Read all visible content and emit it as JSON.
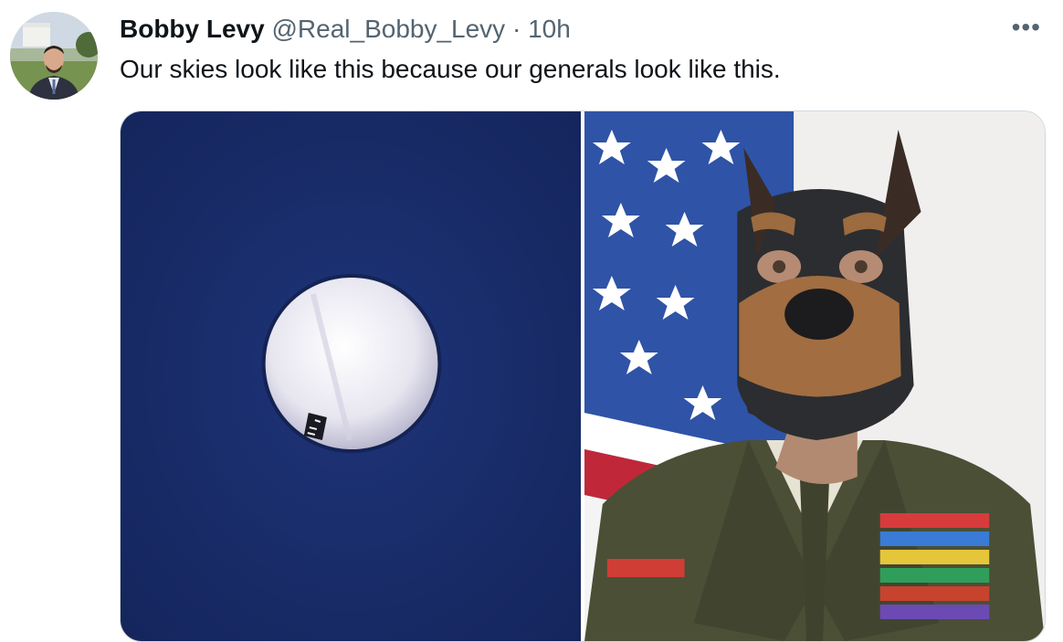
{
  "tweet": {
    "author_name": "Bobby Levy",
    "handle": "@Real_Bobby_Levy",
    "separator": "·",
    "time": "10h",
    "more_icon": "more-horizontal-icon",
    "more_glyph": "•••",
    "text": "Our skies look like this because our generals look like this."
  },
  "media": {
    "photos": [
      {
        "subject": "balloon-photo"
      },
      {
        "subject": "general-photo"
      }
    ]
  },
  "colors": {
    "text": "#0f1419",
    "secondary": "#536471",
    "border": "#cfd9de",
    "sky": "#1b2f6e"
  }
}
